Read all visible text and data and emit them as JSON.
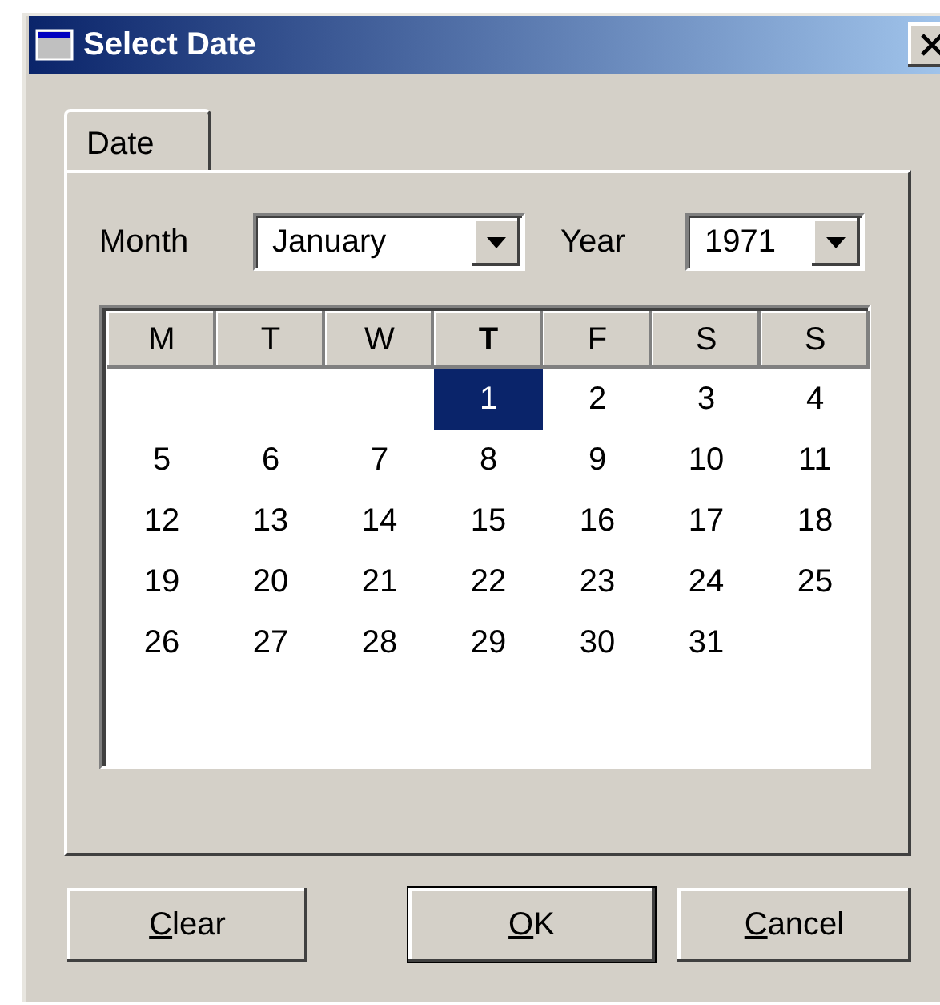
{
  "window": {
    "title": "Select Date"
  },
  "tabs": [
    {
      "label": "Date",
      "selected": true
    }
  ],
  "month": {
    "label": "Month",
    "value": "January"
  },
  "year": {
    "label": "Year",
    "value": "1971"
  },
  "calendar": {
    "headers": [
      {
        "label": "M",
        "selected": false
      },
      {
        "label": "T",
        "selected": false
      },
      {
        "label": "W",
        "selected": false
      },
      {
        "label": "T",
        "selected": true
      },
      {
        "label": "F",
        "selected": false
      },
      {
        "label": "S",
        "selected": false
      },
      {
        "label": "S",
        "selected": false
      }
    ],
    "weeks": [
      [
        {
          "kind": "blank"
        },
        {
          "kind": "blank"
        },
        {
          "kind": "blank"
        },
        {
          "kind": "day",
          "day": "1",
          "selected": true
        },
        {
          "kind": "day",
          "day": "2",
          "selected": false
        },
        {
          "kind": "day",
          "day": "3",
          "selected": false
        },
        {
          "kind": "day",
          "day": "4",
          "selected": false
        }
      ],
      [
        {
          "kind": "day",
          "day": "5",
          "selected": false
        },
        {
          "kind": "day",
          "day": "6",
          "selected": false
        },
        {
          "kind": "day",
          "day": "7",
          "selected": false
        },
        {
          "kind": "day",
          "day": "8",
          "selected": false
        },
        {
          "kind": "day",
          "day": "9",
          "selected": false
        },
        {
          "kind": "day",
          "day": "10",
          "selected": false
        },
        {
          "kind": "day",
          "day": "11",
          "selected": false
        }
      ],
      [
        {
          "kind": "day",
          "day": "12",
          "selected": false
        },
        {
          "kind": "day",
          "day": "13",
          "selected": false
        },
        {
          "kind": "day",
          "day": "14",
          "selected": false
        },
        {
          "kind": "day",
          "day": "15",
          "selected": false
        },
        {
          "kind": "day",
          "day": "16",
          "selected": false
        },
        {
          "kind": "day",
          "day": "17",
          "selected": false
        },
        {
          "kind": "day",
          "day": "18",
          "selected": false
        }
      ],
      [
        {
          "kind": "day",
          "day": "19",
          "selected": false
        },
        {
          "kind": "day",
          "day": "20",
          "selected": false
        },
        {
          "kind": "day",
          "day": "21",
          "selected": false
        },
        {
          "kind": "day",
          "day": "22",
          "selected": false
        },
        {
          "kind": "day",
          "day": "23",
          "selected": false
        },
        {
          "kind": "day",
          "day": "24",
          "selected": false
        },
        {
          "kind": "day",
          "day": "25",
          "selected": false
        }
      ],
      [
        {
          "kind": "day",
          "day": "26",
          "selected": false
        },
        {
          "kind": "day",
          "day": "27",
          "selected": false
        },
        {
          "kind": "day",
          "day": "28",
          "selected": false
        },
        {
          "kind": "day",
          "day": "29",
          "selected": false
        },
        {
          "kind": "day",
          "day": "30",
          "selected": false
        },
        {
          "kind": "day",
          "day": "31",
          "selected": false
        },
        {
          "kind": "blank"
        }
      ]
    ]
  },
  "buttons": [
    {
      "mnemonic": "C",
      "rest": "lear",
      "default": false
    },
    {
      "mnemonic": "O",
      "rest": "K",
      "default": true
    },
    {
      "mnemonic": "C",
      "rest": "ancel",
      "default": false
    }
  ]
}
